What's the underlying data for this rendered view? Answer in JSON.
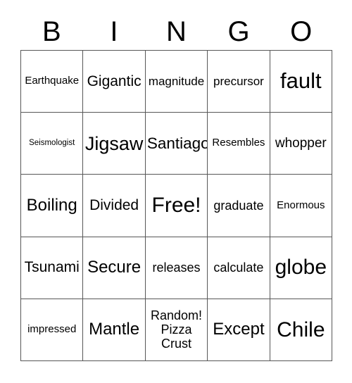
{
  "card": {
    "title": "BINGO",
    "header_letters": [
      "B",
      "I",
      "N",
      "G",
      "O"
    ],
    "rows": [
      [
        {
          "text": "Earthquake",
          "size": "fs-15"
        },
        {
          "text": "Gigantic",
          "size": "fs-21"
        },
        {
          "text": "magnitude",
          "size": "fs-17"
        },
        {
          "text": "precursor",
          "size": "fs-17"
        },
        {
          "text": "fault",
          "size": "fs-31"
        }
      ],
      [
        {
          "text": "Seismologist",
          "size": "fs-11"
        },
        {
          "text": "Jigsaw",
          "size": "fs-27"
        },
        {
          "text": "Santiago",
          "size": "fs-22"
        },
        {
          "text": "Resembles",
          "size": "fs-15"
        },
        {
          "text": "whopper",
          "size": "fs-19"
        }
      ],
      [
        {
          "text": "Boiling",
          "size": "fs-24"
        },
        {
          "text": "Divided",
          "size": "fs-21"
        },
        {
          "text": "Free!",
          "size": "fs-30"
        },
        {
          "text": "graduate",
          "size": "fs-18"
        },
        {
          "text": "Enormous",
          "size": "fs-15"
        }
      ],
      [
        {
          "text": "Tsunami",
          "size": "fs-21"
        },
        {
          "text": "Secure",
          "size": "fs-24"
        },
        {
          "text": "releases",
          "size": "fs-18"
        },
        {
          "text": "calculate",
          "size": "fs-18"
        },
        {
          "text": "globe",
          "size": "fs-30"
        }
      ],
      [
        {
          "text": "impressed",
          "size": "fs-15"
        },
        {
          "text": "Mantle",
          "size": "fs-24"
        },
        {
          "text": "Random!\nPizza\nCrust",
          "size": "fs-18"
        },
        {
          "text": "Except",
          "size": "fs-24"
        },
        {
          "text": "Chile",
          "size": "fs-30"
        }
      ]
    ],
    "free_space": {
      "label": "Free!",
      "row": 2,
      "column": 2
    },
    "colors": {
      "border": "#575757",
      "text": "#000000",
      "background": "#ffffff"
    }
  }
}
